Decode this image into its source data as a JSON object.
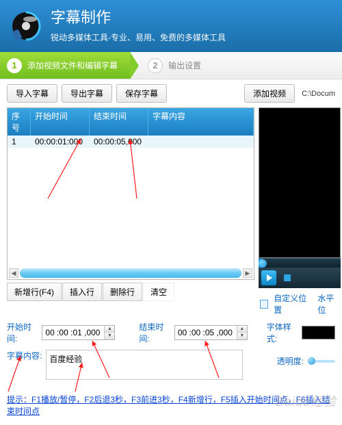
{
  "header": {
    "title": "字幕制作",
    "subtitle": "锐动多媒体工具-专业、易用、免费的多媒体工具"
  },
  "steps": {
    "s1": {
      "num": "1",
      "label": "添加视频文件和编辑字幕"
    },
    "s2": {
      "num": "2",
      "label": "输出设置"
    }
  },
  "toolbar": {
    "import_sub": "导入字幕",
    "export_sub": "导出字幕",
    "save_sub": "保存字幕",
    "add_video": "添加视频",
    "path": "C:\\Docum"
  },
  "table": {
    "headers": {
      "idx": "序号",
      "start": "开始时间",
      "end": "结束时间",
      "content": "字幕内容"
    },
    "rows": [
      {
        "idx": "1",
        "start": "00:00:01:000",
        "end": "00:00:05,000",
        "content": ""
      }
    ]
  },
  "row_actions": {
    "new_row": "新增行(F4)",
    "insert_row": "插入行",
    "delete_row": "删除行",
    "clear": "清空"
  },
  "preview_opts": {
    "custom_pos": "自定义位置",
    "h_pos": "水平位"
  },
  "edit": {
    "start_label": "开始时间:",
    "start_value": "00 :00 :01 ,000",
    "end_label": "结束时间:",
    "end_value": "00 :00 :05 ,000",
    "content_label": "字幕内容:",
    "content_value": "百度经验",
    "font_label": "字体样式:",
    "transparency_label": "透明度:"
  },
  "hints_prefix": "提示：",
  "hints": "F1播放/暂停，F2后退3秒，F3前进3秒，F4新增行，F5插入开始时间点，F6插入结束时间点",
  "watermark": "Baidu经验"
}
